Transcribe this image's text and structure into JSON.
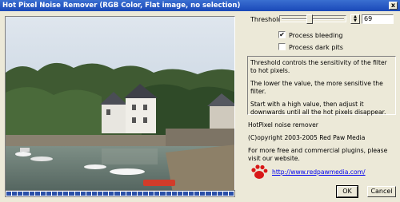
{
  "window": {
    "title": "Hot Pixel Noise Remover (RGB Color, Flat image, no selection)",
    "close_glyph": "x"
  },
  "controls": {
    "threshold_label": "Threshold",
    "threshold_value": "69",
    "threshold_fraction": 0.44,
    "process_bleeding_label": "Process bleeding",
    "process_bleeding_checked": true,
    "process_dark_pits_label": "Process dark pits",
    "process_dark_pits_checked": false
  },
  "info": {
    "lines": [
      "Threshold controls the sensitivity of the filter to hot pixels.",
      "The lower the value, the more sensitive the filter.",
      "Start with a high value, then adjust it downwards until all the hot pixels disappear."
    ]
  },
  "about": {
    "name": "HotPixel noise remover",
    "copyright": "(C)opyright 2003-2005 Red Paw Media",
    "more": "For more free and commercial plugins, please visit our website.",
    "link": "http://www.redpawmedia.com/"
  },
  "buttons": {
    "ok": "OK",
    "cancel": "Cancel"
  },
  "progress": {
    "fraction": 1.0
  },
  "icons": {
    "logo": "red-paw-icon",
    "check": "✔"
  }
}
